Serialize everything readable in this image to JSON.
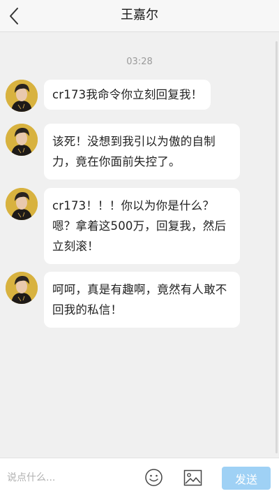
{
  "header": {
    "title": "王嘉尔",
    "back_icon": "chevron-left-icon"
  },
  "chat": {
    "timestamp": "03:28",
    "messages": [
      {
        "text": "cr173我命令你立刻回复我！"
      },
      {
        "text": "该死！没想到我引以为傲的自制力，竟在你面前失控了。"
      },
      {
        "text": "cr173！！！你以为你是什么？嗯？拿着这500万，回复我，然后立刻滚！"
      },
      {
        "text": "呵呵，真是有趣啊，竟然有人敢不回我的私信！"
      }
    ]
  },
  "composer": {
    "placeholder": "说点什么...",
    "emoji_icon": "smiley-icon",
    "image_icon": "image-icon",
    "send_label": "发送"
  },
  "colors": {
    "background": "#f0f0f0",
    "bubble": "#ffffff",
    "send_button": "#9fd1f5",
    "avatar_bg": "#d8b23f"
  }
}
